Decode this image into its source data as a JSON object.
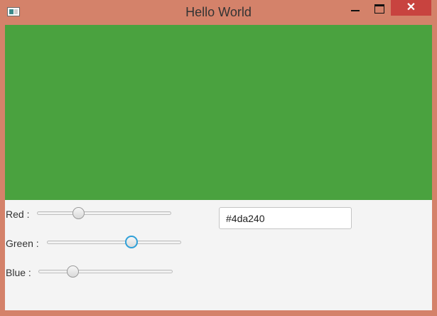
{
  "window": {
    "title": "Hello World",
    "close_glyph": "✕",
    "icons": [
      "app-icon",
      "minimize-icon",
      "maximize-icon",
      "close-icon"
    ]
  },
  "preview": {
    "color": "#4aa23f"
  },
  "controls": {
    "red": {
      "label": "Red :",
      "value": 0.31
    },
    "green": {
      "label": "Green :",
      "value": 0.63
    },
    "blue": {
      "label": "Blue :",
      "value": 0.26
    }
  },
  "hex": {
    "value": "#4da240"
  }
}
